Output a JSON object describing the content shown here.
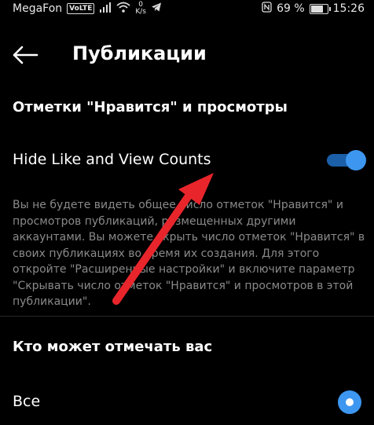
{
  "status_bar": {
    "carrier": "MegaFon",
    "volte": "VoLTE",
    "speed_value": "0",
    "speed_unit": "K/s",
    "battery": "69 %",
    "time": "15:26"
  },
  "header": {
    "title": "Публикации"
  },
  "likes_section": {
    "title": "Отметки \"Нравится\" и просмотры",
    "toggle_label": "Hide Like and View Counts",
    "toggle_on": true,
    "description": "Вы не будете видеть общее число отметок \"Нравится\" и просмотров публикаций, размещенных другими аккаунтами. Вы можете скрыть число отметок \"Нравится\" в своих публикациях во время их создания. Для этого откройте \"Расширенные настройки\" и включите параметр \"Скрывать число отметок \"Нравится\" и просмотров в этой публикации\"."
  },
  "tagging_section": {
    "title": "Кто может отмечать вас",
    "option_label": "Все",
    "option_selected": true
  },
  "colors": {
    "accent": "#3d97f0",
    "annotation_arrow": "#e8252b"
  }
}
